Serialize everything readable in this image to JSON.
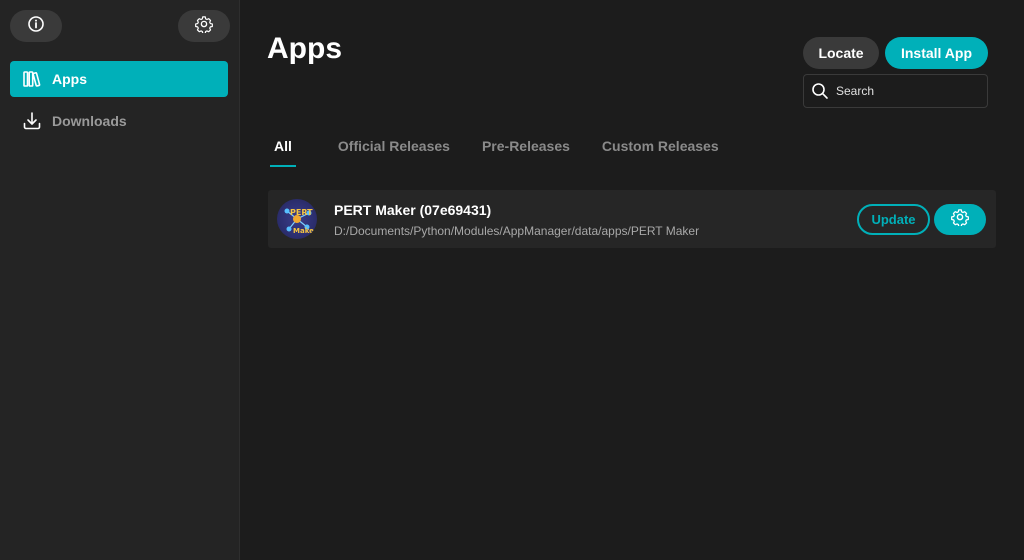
{
  "sidebar": {
    "top_buttons": [
      {
        "icon": "info-icon"
      },
      {
        "icon": "gear-icon"
      }
    ],
    "items": [
      {
        "label": "Apps",
        "icon": "library-icon",
        "active": true
      },
      {
        "label": "Downloads",
        "icon": "download-icon",
        "active": false
      }
    ]
  },
  "main": {
    "title": "Apps",
    "actions": {
      "locate_label": "Locate",
      "install_label": "Install App"
    },
    "search": {
      "placeholder": "Search",
      "value": ""
    },
    "tabs": [
      {
        "label": "All",
        "active": true
      },
      {
        "label": "Official Releases",
        "active": false
      },
      {
        "label": "Pre-Releases",
        "active": false
      },
      {
        "label": "Custom Releases",
        "active": false
      }
    ],
    "apps": [
      {
        "name": "PERT Maker (07e69431)",
        "path": "D:/Documents/Python/Modules/AppManager/data/apps/PERT Maker",
        "icon_text_1": "PERT",
        "icon_text_2": "Maker",
        "update_label": "Update"
      }
    ]
  },
  "colors": {
    "accent": "#00b0b9",
    "background": "#1c1c1c",
    "sidebar": "#242424",
    "button_dark": "#3a3a3a"
  }
}
